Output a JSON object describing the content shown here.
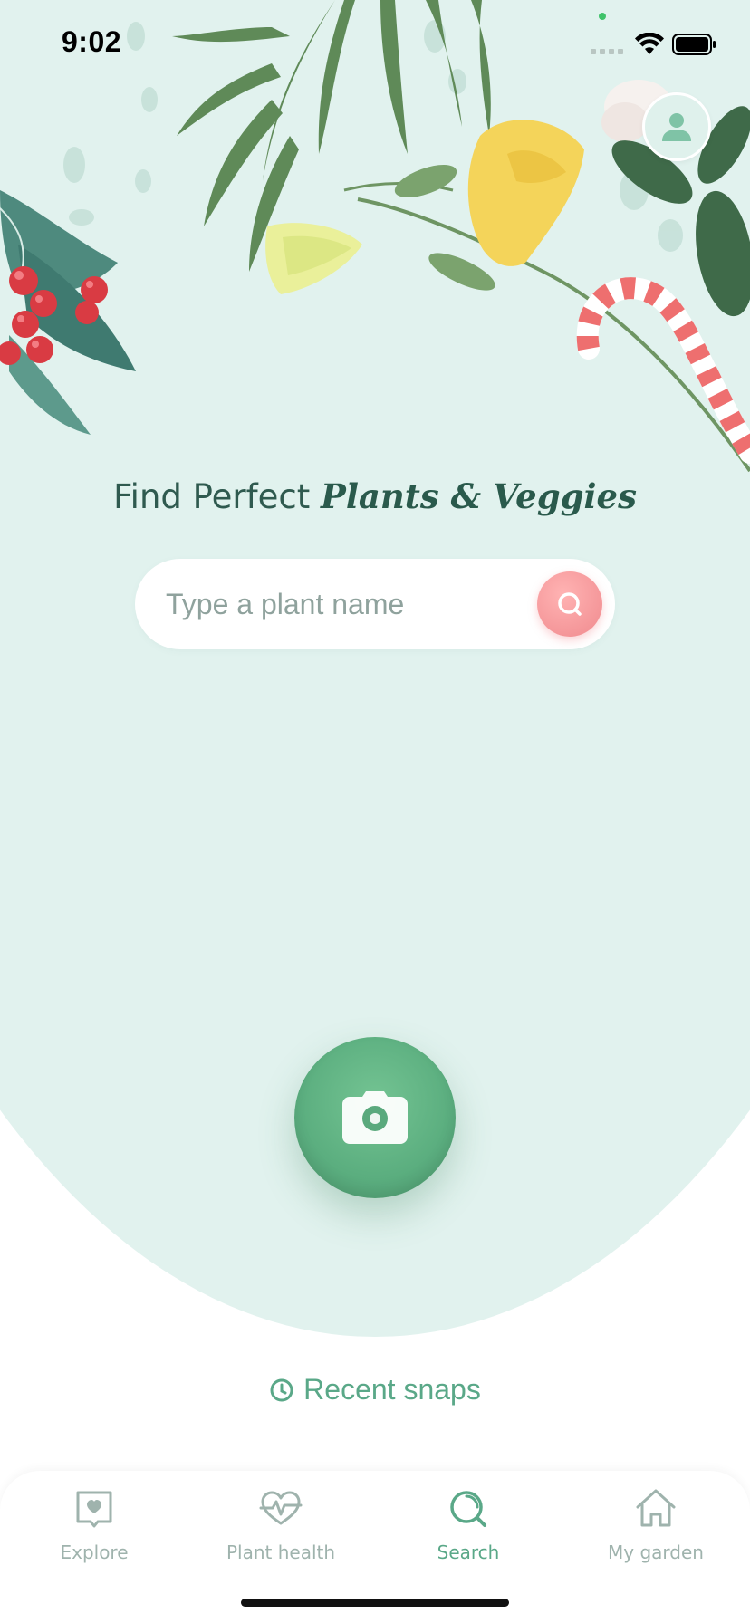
{
  "status_bar": {
    "time": "9:02",
    "icons": [
      "cellular-signal-icon",
      "wifi-icon",
      "battery-icon"
    ]
  },
  "header": {
    "avatar_icon": "user-profile-icon",
    "headline_lead": "Find Perfect ",
    "headline_emphasis": "Plants & Veggies"
  },
  "search": {
    "placeholder": "Type a plant name",
    "value": "",
    "button_icon": "search-icon"
  },
  "camera": {
    "icon": "camera-icon"
  },
  "recent": {
    "icon": "clock-icon",
    "label": "Recent snaps"
  },
  "tabs": [
    {
      "label": "Explore",
      "icon": "explore-book-icon",
      "active": false
    },
    {
      "label": "Plant health",
      "icon": "heartbeat-icon",
      "active": false
    },
    {
      "label": "Search",
      "icon": "search-icon",
      "active": true
    },
    {
      "label": "My garden",
      "icon": "house-icon",
      "active": false
    }
  ],
  "colors": {
    "background_mint": "#e1f2ee",
    "accent_green": "#5aa888",
    "camera_green": "#5bae7f",
    "search_button_pink": "#f08a8e",
    "headline_text": "#2f5a4f",
    "inactive_tab": "#9fb3ad"
  }
}
